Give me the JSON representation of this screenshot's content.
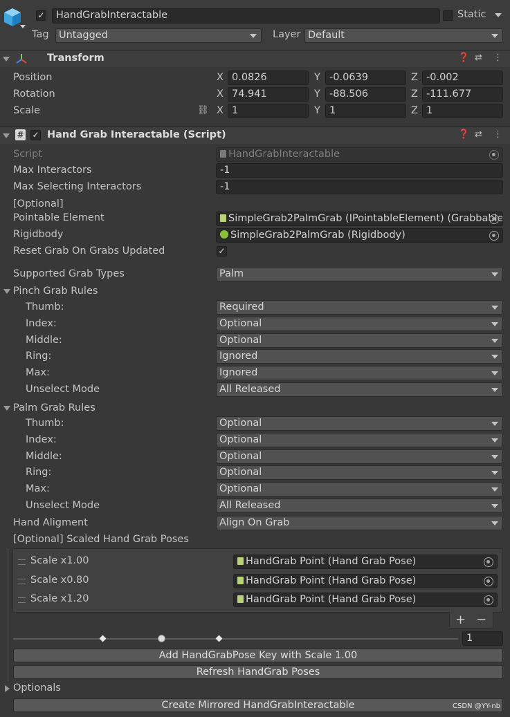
{
  "header": {
    "object_name": "HandGrabInteractable",
    "static_label": "Static",
    "tag_label": "Tag",
    "tag_value": "Untagged",
    "layer_label": "Layer",
    "layer_value": "Default",
    "active_checked": true,
    "static_checked": false
  },
  "transform": {
    "title": "Transform",
    "rows": [
      {
        "label": "Position",
        "x": "0.0826",
        "y": "-0.0639",
        "z": "-0.002"
      },
      {
        "label": "Rotation",
        "x": "74.941",
        "y": "-88.506",
        "z": "-111.677"
      },
      {
        "label": "Scale",
        "x": "1",
        "y": "1",
        "z": "1"
      }
    ],
    "axes": {
      "x": "X",
      "y": "Y",
      "z": "Z"
    }
  },
  "script": {
    "title": "Hand Grab Interactable (Script)",
    "script_label": "Script",
    "script_value": "HandGrabInteractable",
    "max_interactors_label": "Max Interactors",
    "max_interactors_value": "-1",
    "max_selecting_label": "Max Selecting Interactors",
    "max_selecting_value": "-1",
    "optional_label": "[Optional]",
    "pointable_label": "Pointable Element",
    "pointable_value": "SimpleGrab2PalmGrab (IPointableElement) (Grabbable",
    "rigidbody_label": "Rigidbody",
    "rigidbody_value": "SimpleGrab2PalmGrab (Rigidbody)",
    "reset_label": "Reset Grab On Grabs Updated",
    "reset_checked": true,
    "supported_label": "Supported Grab Types",
    "supported_value": "Palm",
    "pinch": {
      "title": "Pinch Grab Rules",
      "rows": [
        {
          "label": "Thumb:",
          "value": "Required"
        },
        {
          "label": "Index:",
          "value": "Optional"
        },
        {
          "label": "Middle:",
          "value": "Optional"
        },
        {
          "label": "Ring:",
          "value": "Ignored"
        },
        {
          "label": "Max:",
          "value": "Ignored"
        },
        {
          "label": "Unselect Mode",
          "value": "All Released"
        }
      ]
    },
    "palm": {
      "title": "Palm Grab Rules",
      "rows": [
        {
          "label": "Thumb:",
          "value": "Optional"
        },
        {
          "label": "Index:",
          "value": "Optional"
        },
        {
          "label": "Middle:",
          "value": "Optional"
        },
        {
          "label": "Ring:",
          "value": "Optional"
        },
        {
          "label": "Max:",
          "value": "Optional"
        },
        {
          "label": "Unselect Mode",
          "value": "All Released"
        }
      ]
    },
    "alignment_label": "Hand Aligment",
    "alignment_value": "Align On Grab",
    "poses_label": "[Optional] Scaled Hand Grab Poses",
    "poses": [
      {
        "label": "Scale x1.00",
        "value": "HandGrab Point (Hand Grab Pose)"
      },
      {
        "label": "Scale x0.80",
        "value": "HandGrab Point (Hand Grab Pose)"
      },
      {
        "label": "Scale x1.20",
        "value": "HandGrab Point (Hand Grab Pose)"
      }
    ],
    "plus": "+",
    "minus": "−",
    "slider_value": "1",
    "add_button": "Add HandGrabPose Key with Scale 1.00",
    "refresh_button": "Refresh HandGrab Poses",
    "optionals_label": "Optionals",
    "mirror_button": "Create Mirrored HandGrabInteractable"
  },
  "watermark": "CSDN @YY-nb",
  "icons": [
    "cube-icon",
    "transform-axes-icon",
    "help-icon",
    "settings-icon",
    "more-icon",
    "script-hash-icon",
    "object-picker-icon",
    "link-icon"
  ]
}
